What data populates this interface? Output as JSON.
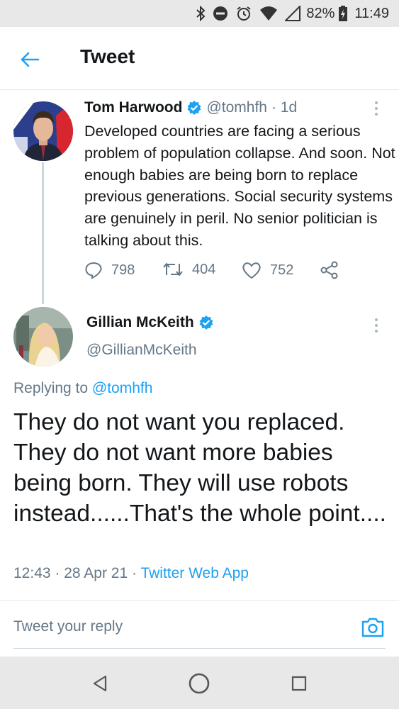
{
  "status_bar": {
    "battery": "82%",
    "time": "11:49",
    "icons": [
      "bluetooth-icon",
      "dnd-icon",
      "alarm-icon",
      "wifi-icon",
      "signal-icon",
      "battery-charging-icon"
    ]
  },
  "header": {
    "title": "Tweet",
    "back_icon": "back-arrow-icon"
  },
  "parent_tweet": {
    "name": "Tom Harwood",
    "handle": "@tomhfh",
    "time": "· 1d",
    "text": "Developed countries are facing a serious problem of population collapse. And soon. Not enough babies are being born to replace previous generations. Social security systems are genuinely in peril. No senior politician is talking about this.",
    "replies": "798",
    "retweets": "404",
    "likes": "752"
  },
  "focused_tweet": {
    "name": "Gillian McKeith",
    "handle": "@GillianMcKeith",
    "replying_label": "Replying to ",
    "replying_handle": "@tomhfh",
    "text": "They do not want you replaced. They do not want more babies being born. They will use robots instead......That's the whole point....",
    "time": "12:43",
    "date": "28 Apr 21",
    "source": "Twitter Web App",
    "separator": " · "
  },
  "reply_box": {
    "placeholder": "Tweet your reply"
  },
  "colors": {
    "accent": "#1da1f2",
    "text": "#14171a",
    "muted": "#657786",
    "status_bar": "#e8e8e8"
  }
}
